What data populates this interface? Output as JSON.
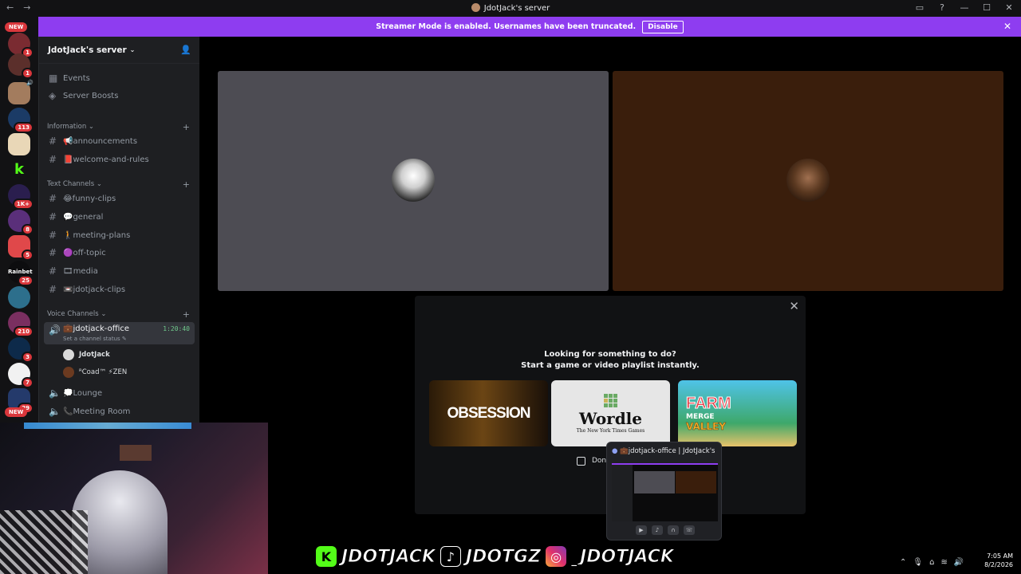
{
  "window": {
    "title": "JdotJack's server",
    "back": "←",
    "forward": "→",
    "icons": [
      "inbox-icon",
      "help-icon",
      "minimize-icon",
      "maximize-icon",
      "close-icon"
    ]
  },
  "banner": {
    "text": "Streamer Mode is enabled. Usernames have been truncated.",
    "button": "Disable",
    "close": "✕",
    "color": "#8e3df0"
  },
  "guilds": {
    "new_top": "NEW",
    "new_bottom": "NEW",
    "badges": [
      "1",
      "1",
      "113",
      "1K+",
      "8",
      "5",
      "25",
      "210",
      "3",
      "7",
      "29"
    ]
  },
  "server": {
    "name": "JdotJack's server",
    "chevron": "⌄",
    "top_items": [
      {
        "icon": "calendar-icon",
        "label": "Events"
      },
      {
        "icon": "boost-icon",
        "label": "Server Boosts"
      }
    ],
    "categories": [
      {
        "name": "Information",
        "channels": [
          "📢announcements",
          "📕welcome-and-rules"
        ]
      },
      {
        "name": "Text Channels",
        "channels": [
          "😂funny-clips",
          "💬general",
          "🚶meeting-plans",
          "🟣off-topic",
          "🎞media",
          "📼jdotjack-clips"
        ]
      },
      {
        "name": "Voice Channels"
      }
    ],
    "voice": {
      "active_channel": "💼jdotjack-office",
      "timer": "1:20:40",
      "status": "Set a channel status",
      "users": [
        "JdotJack",
        "ᴿCoad™ ⚡ZEN"
      ],
      "others": [
        "💭Lounge",
        "📞Meeting Room"
      ]
    }
  },
  "activity": {
    "line1": "Looking for something to do?",
    "line2": "Start a game or video playlist instantly.",
    "cards": [
      "OBSESSION",
      "Wordle",
      "The New York Times Games",
      "FARM",
      "MERGE",
      "VALLEY"
    ],
    "checkbox_label": "Don't",
    "close": "✕"
  },
  "preview": {
    "title": "💼jdotjack-office | JdotJack's server"
  },
  "socials": {
    "kick": "JDOTJACK",
    "tiktok": "JDOTGZ",
    "instagram": "_JDOTJACK"
  },
  "clock": {
    "time": "7:05 AM",
    "date": "8/2/2026"
  }
}
